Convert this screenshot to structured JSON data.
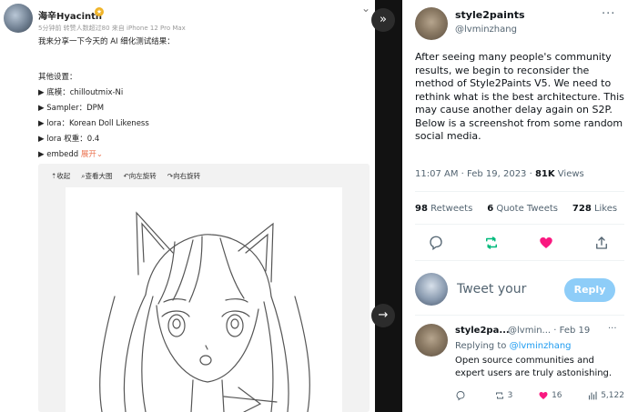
{
  "weibo": {
    "user_name": "海辛Hyacinth",
    "meta": "5分钟前 转赞人数超过80 来自 iPhone 12 Pro Max",
    "lines": [
      "我来分享一下今天的 AI 细化测试结果：",
      "",
      "其他设置：",
      "▶ 底模：chilloutmix-Ni",
      "▶ Sampler：DPM",
      "▶ lora：Korean Doll Likeness",
      "▶ lora 权重：0.4",
      "▶ embedd"
    ],
    "expand_label": "展开",
    "tools": [
      "收起",
      "查看大图",
      "向左旋转",
      "向右旋转"
    ]
  },
  "divider": {
    "forward_icon": "double-chevron-right-icon",
    "next_icon": "arrow-right-icon"
  },
  "tweet": {
    "author_name": "style2paints",
    "author_handle": "@lvminzhang",
    "more_label": "···",
    "body": "After seeing many people's community results, we begin to reconsider the method of Style2Paints V5. We need to rethink what is the best architecture. This may cause another delay again on S2P.\nBelow is a screenshot from some random social media.",
    "time": "11:07 AM · Feb 19, 2023 · ",
    "views_count": "81K",
    "views_label": " Views",
    "retweets_count": "98",
    "retweets_label": " Retweets",
    "quotes_count": "6",
    "quotes_label": " Quote Tweets",
    "likes_count": "728",
    "likes_label": " Likes",
    "reply_placeholder": "Tweet your",
    "reply_button": "Reply",
    "colors": {
      "accent": "#1d9bf0",
      "retweet": "#00ba7c",
      "like": "#f91880",
      "reply_button": "#8ecdf8"
    }
  },
  "reply": {
    "author_name": "style2pa...",
    "author_handle": "@lvmin... · Feb 19",
    "more_label": "···",
    "replying_prefix": "Replying to ",
    "replying_handle": "@lvminzhang",
    "body": "Open source communities and expert users are truly astonishing.",
    "reply_count": "",
    "retweet_count": "3",
    "like_count": "16",
    "views_count": "5,122"
  }
}
